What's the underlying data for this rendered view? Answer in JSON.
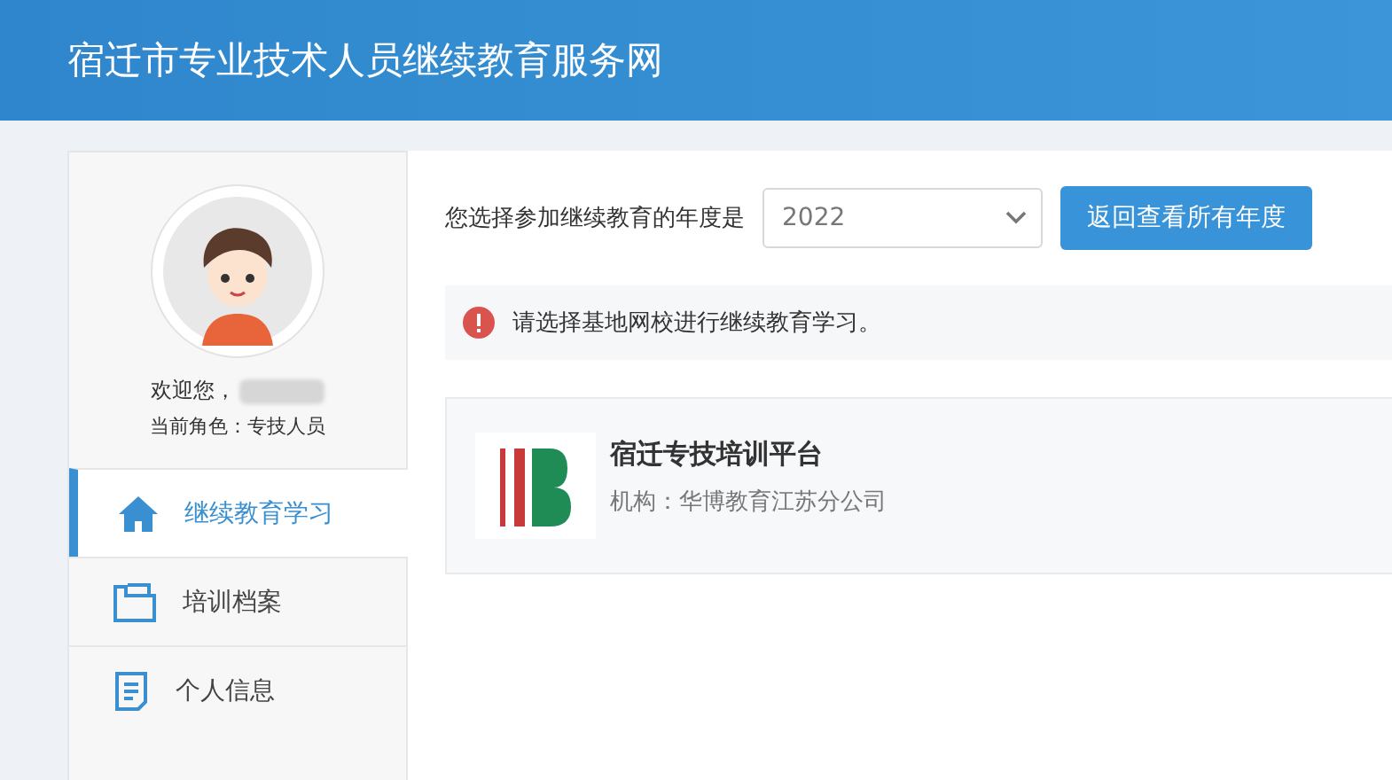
{
  "header": {
    "title": "宿迁市专业技术人员继续教育服务网"
  },
  "sidebar": {
    "welcome": "欢迎您，",
    "role": "当前角色：专技人员",
    "items": [
      {
        "label": "继续教育学习",
        "selected": true
      },
      {
        "label": "培训档案",
        "selected": false
      },
      {
        "label": "个人信息",
        "selected": false
      }
    ]
  },
  "year_picker": {
    "label": "您选择参加继续教育的年度是",
    "value": "2022",
    "button": "返回查看所有年度"
  },
  "alert": {
    "message": "请选择基地网校进行继续教育学习。"
  },
  "platforms": [
    {
      "name": "宿迁专技培训平台",
      "org": "机构：华博教育江苏分公司"
    }
  ]
}
